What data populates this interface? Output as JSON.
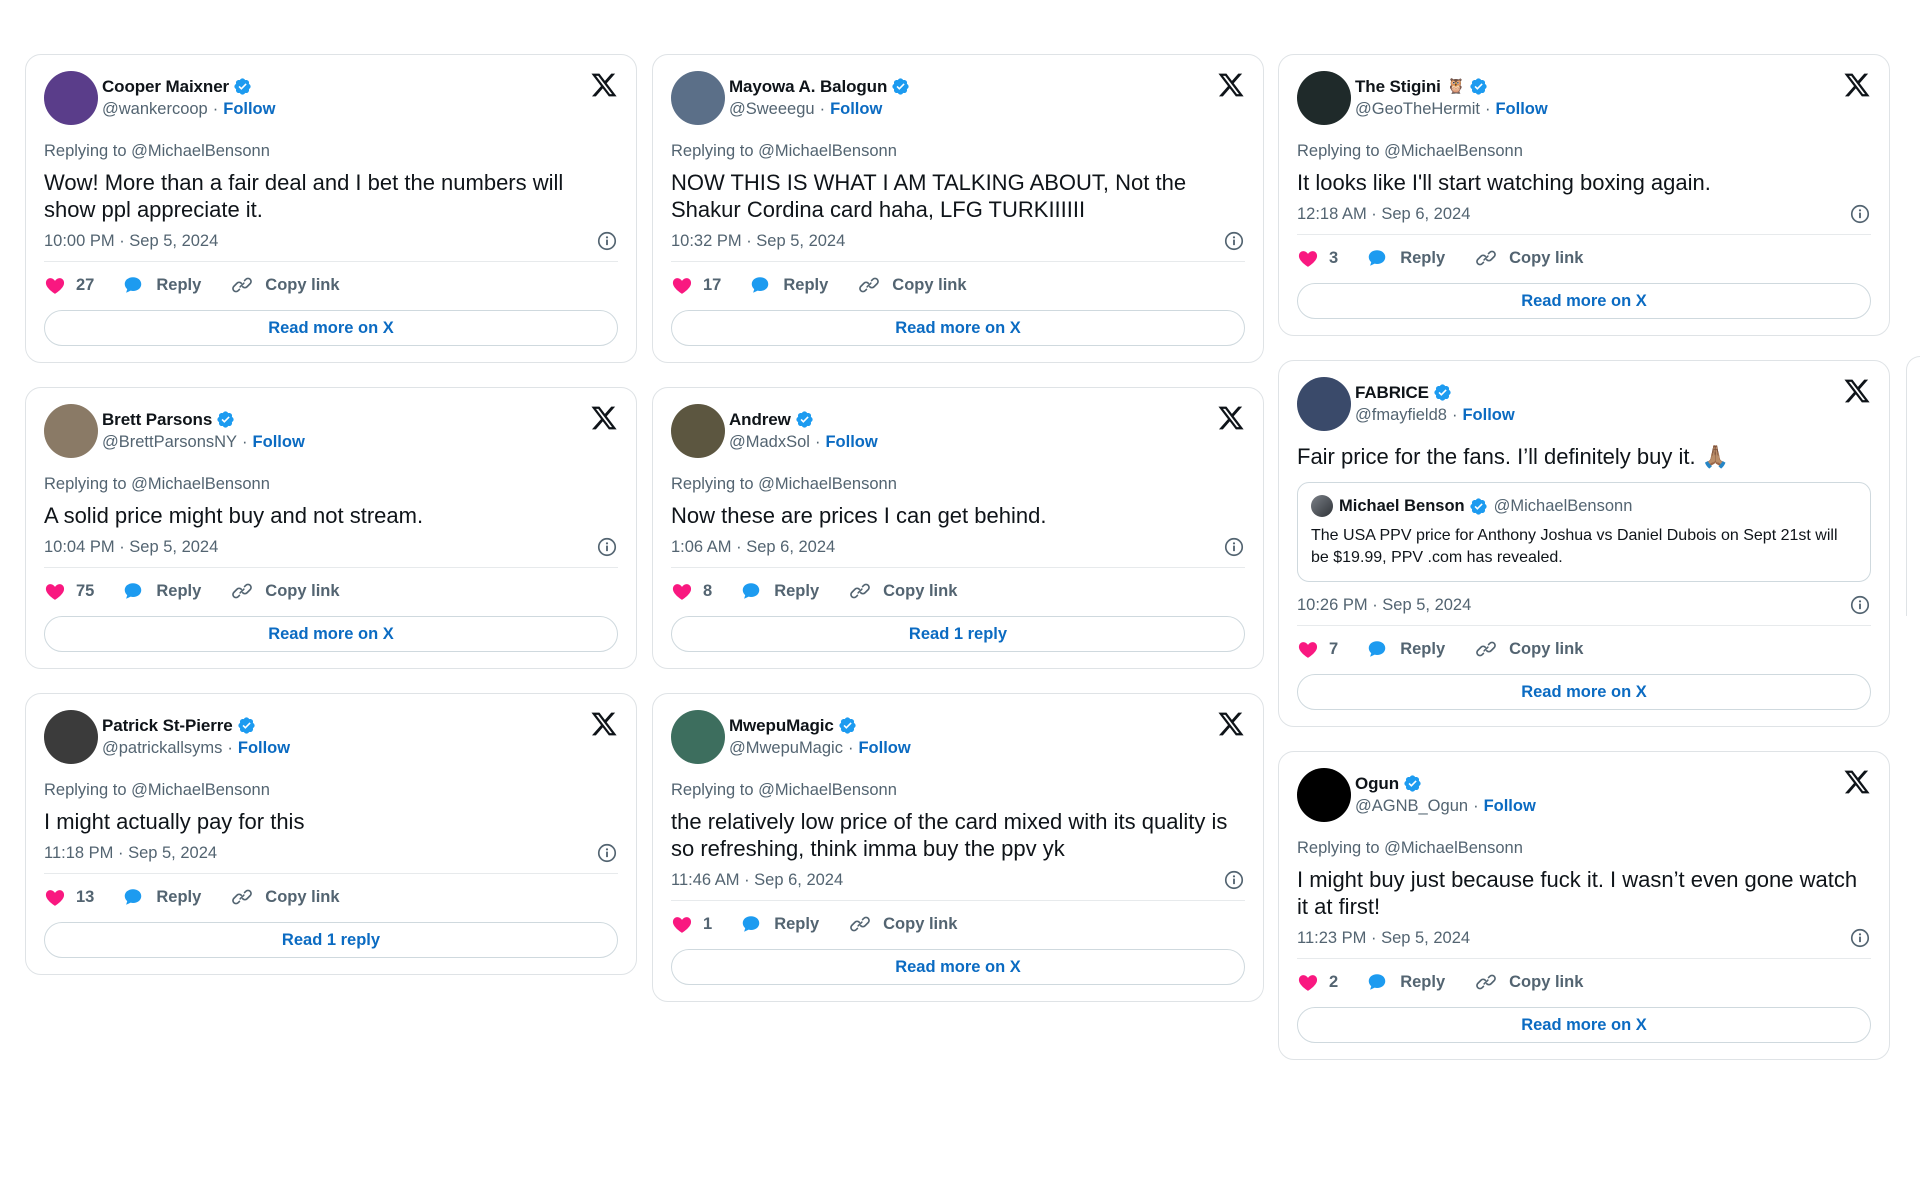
{
  "ui": {
    "read_more": "Read more on X",
    "reply_label": "Reply",
    "copy_link_label": "Copy link",
    "follow_label": "Follow",
    "replying_prefix": "Replying to @MichaelBenson",
    "colors": {
      "like": "#f91880",
      "reply": "#1d9bf0",
      "verified": "#1d9bf0",
      "link": "#0b6bc2"
    }
  },
  "columns": [
    [
      {
        "name": "Cooper Maixner",
        "handle": "@wankercoop",
        "replying_to": "Replying to @MichaelBensonn",
        "text": "Wow! More than a fair deal and I bet the numbers will show ppl appreciate it.",
        "time": "10:00 PM · Sep 5, 2024",
        "likes": "27",
        "button": "Read more on X",
        "avatar_color": "#5a3d8a"
      },
      {
        "name": "Brett Parsons",
        "handle": "@BrettParsonsNY",
        "replying_to": "Replying to @MichaelBensonn",
        "text": "A solid price might buy and not stream.",
        "time": "10:04 PM · Sep 5, 2024",
        "likes": "75",
        "button": "Read more on X",
        "avatar_color": "#8a7a66"
      },
      {
        "name": "Patrick St-Pierre",
        "handle": "@patrickallsyms",
        "replying_to": "Replying to @MichaelBensonn",
        "text": "I might actually pay for this",
        "time": "11:18 PM · Sep 5, 2024",
        "likes": "13",
        "button": "Read 1 reply",
        "avatar_color": "#3b3b3b"
      }
    ],
    [
      {
        "name": "Mayowa A. Balogun",
        "handle": "@Sweeegu",
        "replying_to": "Replying to @MichaelBensonn",
        "text": "NOW THIS IS WHAT I AM TALKING ABOUT, Not the Shakur Cordina card haha, LFG TURKIIIIII",
        "time": "10:32 PM · Sep 5, 2024",
        "likes": "17",
        "button": "Read more on X",
        "avatar_color": "#5b6f88"
      },
      {
        "name": "Andrew",
        "handle": "@MadxSol",
        "replying_to": "Replying to @MichaelBensonn",
        "text": "Now these are prices I can get behind.",
        "time": "1:06 AM · Sep 6, 2024",
        "likes": "8",
        "button": "Read 1 reply",
        "avatar_color": "#5c5640"
      },
      {
        "name": "MwepuMagic",
        "handle": "@MwepuMagic",
        "replying_to": "Replying to @MichaelBensonn",
        "text": "the relatively low price of the card mixed with its quality is so refreshing, think imma buy the ppv yk",
        "time": "11:46 AM · Sep 6, 2024",
        "likes": "1",
        "button": "Read more on X",
        "avatar_color": "#3d6e5e"
      }
    ],
    [
      {
        "name": "The Stigini",
        "emoji": "🦉",
        "handle": "@GeoTheHermit",
        "replying_to": "Replying to @MichaelBensonn",
        "text": "It looks like I'll start watching boxing again.",
        "time": "12:18 AM · Sep 6, 2024",
        "likes": "3",
        "button": "Read more on X",
        "avatar_color": "#1f2a2a"
      },
      {
        "name": "FABRICE",
        "handle": "@fmayfield8",
        "text": "Fair price for the fans. I’ll definitely buy it. 🙏🏽",
        "quote": {
          "name": "Michael Benson",
          "handle": "@MichaelBensonn",
          "text": "The USA PPV price for Anthony Joshua vs Daniel Dubois on Sept 21st will be $19.99, PPV .com has revealed."
        },
        "time": "10:26 PM · Sep 5, 2024",
        "likes": "7",
        "button": "Read more on X",
        "avatar_color": "#3a4a6a"
      },
      {
        "name": "Ogun",
        "handle": "@AGNB_Ogun",
        "replying_to": "Replying to @MichaelBensonn",
        "text": "I might buy just because fuck it. I wasn’t even gone watch it at first!",
        "time": "11:23 PM · Sep 5, 2024",
        "likes": "2",
        "button": "Read more on X",
        "avatar_color": "#000000"
      }
    ]
  ]
}
